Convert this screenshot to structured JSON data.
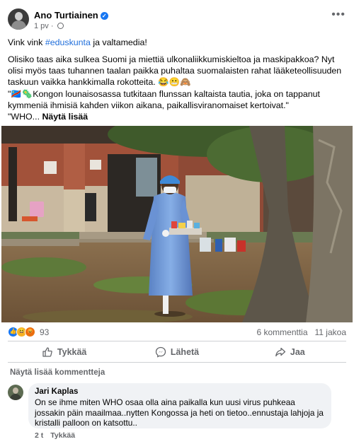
{
  "post": {
    "author": "Ano Turtiainen",
    "time": "1 pv",
    "line1_pre": "Vink vink ",
    "hashtag": "#eduskunta",
    "line1_post": " ja valtamedia!",
    "paragraph2": "Olisiko taas aika sulkea Suomi ja miettiä ulkonaliikkumiskieltoa ja maskipakkoa? Nyt olisi myös taas tuhannen taalan paikka puhaltaa suomalaisten rahat lääketeollisuuden taskuun vaikka hankkimalla rokotteita. 😂😬🙈",
    "quote": "\"🇨🇩🦠Kongon lounaisosassa tutkitaan flunssan kaltaista tautia, joka on tappanut kymmeniä ihmisiä kahden viikon aikana, paikallisviranomaiset kertoivat.\"",
    "who_prefix": "\"WHO... ",
    "see_more": "Näytä lisää"
  },
  "engagement": {
    "reaction_count": "93",
    "comments": "6 kommenttia",
    "shares": "11 jakoa"
  },
  "actions": {
    "like": "Tykkää",
    "send": "Lähetä",
    "share": "Jaa"
  },
  "comments_section": {
    "more_comments": "Näytä lisää kommentteja",
    "comment": {
      "author": "Jari Kaplas",
      "text": "On se ihme miten WHO osaa olla aina paikalla kun uusi virus puhkeaa jossakin päin maailmaa..nytten Kongossa ja heti on tietoo..ennustaja lahjoja ja kristalli palloon on katsottu..",
      "time": "2 t",
      "like": "Tykkää"
    }
  },
  "icons": {
    "verified": "verified-badge-icon",
    "globe": "globe-icon",
    "more": "more-options-icon",
    "like": "thumbs-up-icon",
    "send": "messenger-icon",
    "share": "share-arrow-icon"
  },
  "colors": {
    "accent": "#1877f2",
    "secondary_text": "#65676b",
    "comment_bg": "#f0f2f5"
  }
}
